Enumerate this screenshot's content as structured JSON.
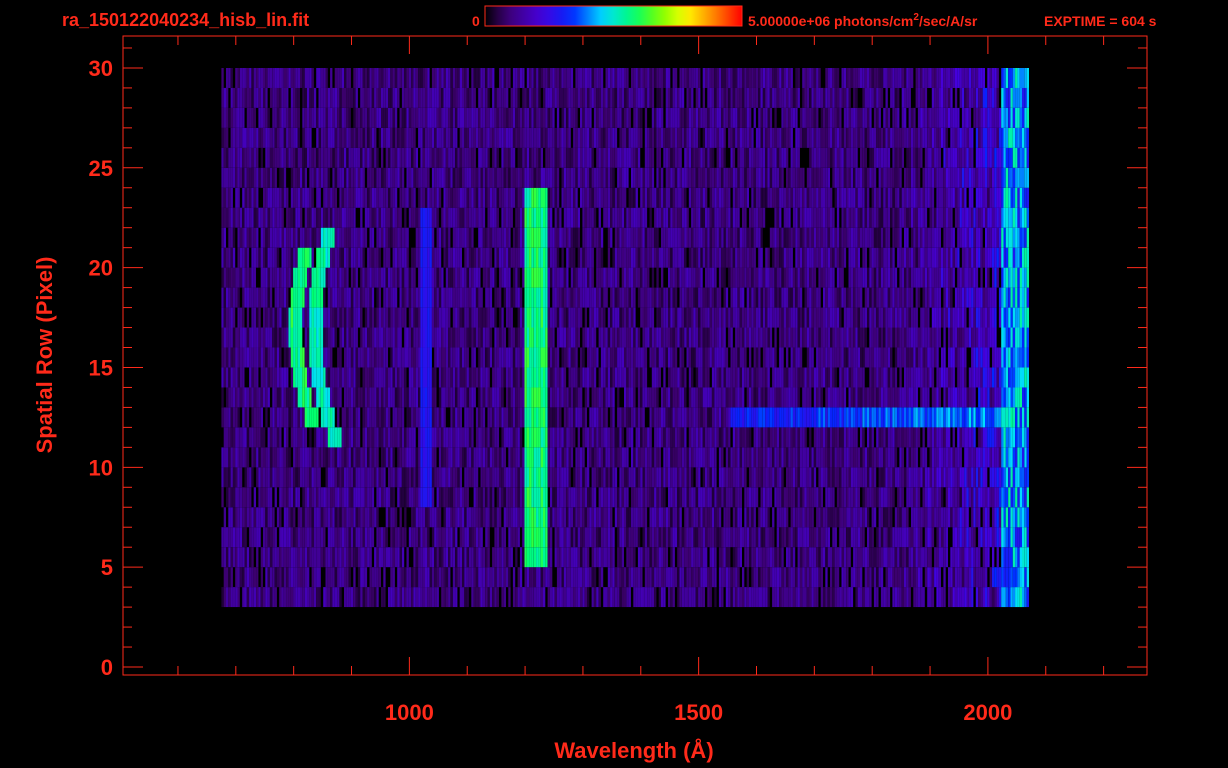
{
  "header": {
    "filename": "ra_150122040234_hisb_lin.fit",
    "colorbar_min": "0",
    "colorbar_max": "5.00000e+06 photons/cm",
    "colorbar_max_sup": "2",
    "colorbar_units_tail": "/sec/A/sr",
    "exptime": "EXPTIME = 604 s"
  },
  "colors": {
    "axis": "#ff2a1a",
    "background": "#000000"
  },
  "chart_data": {
    "type": "heatmap",
    "title": "ra_150122040234_hisb_lin.fit",
    "xlabel": "Wavelength (Å)",
    "ylabel": "Spatial Row (Pixel)",
    "xlim": [
      505,
      2275
    ],
    "ylim": [
      -0.4,
      31.6
    ],
    "x_ticks": [
      1000,
      1500,
      2000
    ],
    "x_tick_labels": [
      "1000",
      "1500",
      "2000"
    ],
    "y_ticks": [
      0,
      5,
      10,
      15,
      20,
      25,
      30
    ],
    "y_tick_labels": [
      "0",
      "5",
      "10",
      "15",
      "20",
      "25",
      "30"
    ],
    "colorbar": {
      "min": 0,
      "max": 5000000,
      "units": "photons/cm^2/sec/A/sr",
      "colormap": "rainbow"
    },
    "exptime_s": 604,
    "grid": false,
    "noise_region": {
      "x_range": [
        675,
        2070
      ],
      "row_range": [
        3,
        30
      ]
    },
    "features": [
      {
        "name": "Ly-alpha band",
        "x_center": 1216,
        "x_width": 20,
        "row_range": [
          5,
          24
        ],
        "intensity": 0.6
      },
      {
        "name": "line ~1026",
        "x_center": 1026,
        "x_width": 10,
        "row_range": [
          8,
          23
        ],
        "intensity": 0.3
      },
      {
        "name": "arc ~835",
        "x_center": 835,
        "x_width": 12,
        "row_range": [
          11,
          22
        ],
        "intensity": 0.55,
        "curvature": 34
      },
      {
        "name": "arc ~800",
        "x_center": 800,
        "x_width": 12,
        "row_range": [
          12,
          21
        ],
        "intensity": 0.6,
        "curvature": 30
      },
      {
        "name": "continuum stripe",
        "x_range": [
          1555,
          2040
        ],
        "row": 12.5,
        "row_width": 1,
        "intensity": 0.45
      },
      {
        "name": "red edge",
        "x_range": [
          2020,
          2075
        ],
        "row_range": [
          2,
          30
        ],
        "intensity": 0.55
      }
    ]
  }
}
